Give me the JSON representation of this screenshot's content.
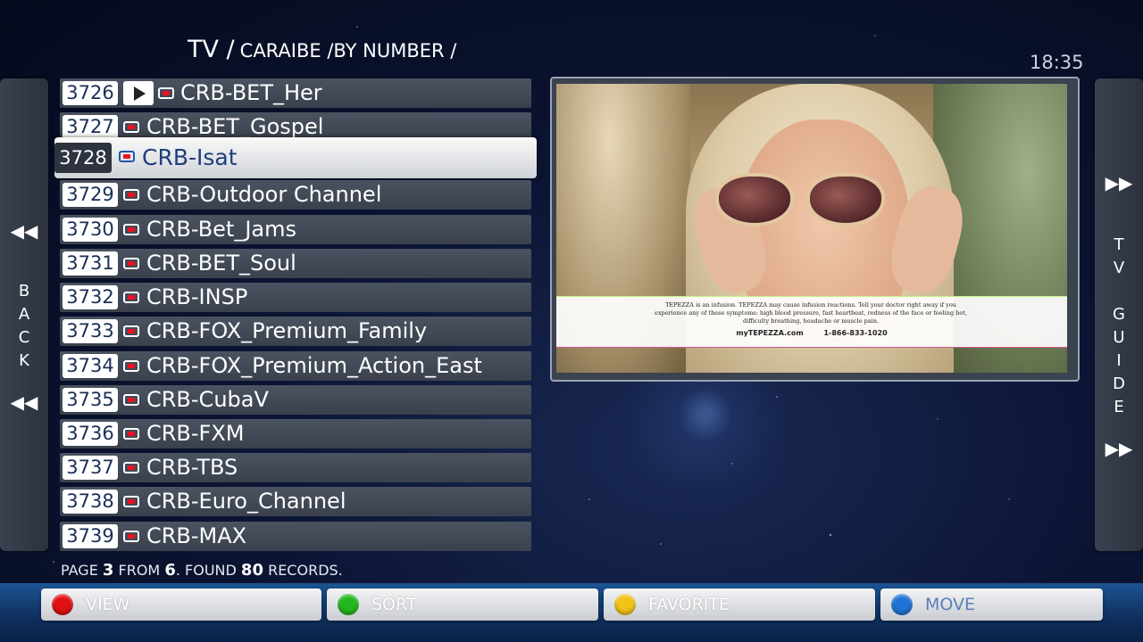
{
  "header": {
    "title_main": "TV /",
    "title_sub": "CARAIBE /BY NUMBER /",
    "clock": "18:35"
  },
  "left_panel": {
    "letters": [
      "B",
      "A",
      "C",
      "K"
    ],
    "arrow_top": "◀◀",
    "arrow_bottom": "◀◀"
  },
  "right_panel": {
    "tv_letters": [
      "T",
      "V"
    ],
    "guide_letters": [
      "G",
      "U",
      "I",
      "D",
      "E"
    ],
    "arrow_top": "▶▶",
    "arrow_bottom": "▶▶"
  },
  "channels": [
    {
      "num": "3726",
      "name": "CRB-BET_Her"
    },
    {
      "num": "3727",
      "name": "CRB-BET_Gospel"
    },
    {
      "num": "3728",
      "name": "CRB-Isat"
    },
    {
      "num": "3729",
      "name": "CRB-Outdoor Channel"
    },
    {
      "num": "3730",
      "name": "CRB-Bet_Jams"
    },
    {
      "num": "3731",
      "name": "CRB-BET_Soul"
    },
    {
      "num": "3732",
      "name": "CRB-INSP"
    },
    {
      "num": "3733",
      "name": "CRB-FOX_Premium_Family"
    },
    {
      "num": "3734",
      "name": "CRB-FOX_Premium_Action_East"
    },
    {
      "num": "3735",
      "name": "CRB-CubaV"
    },
    {
      "num": "3736",
      "name": "CRB-FXM"
    },
    {
      "num": "3737",
      "name": "CRB-TBS"
    },
    {
      "num": "3738",
      "name": "CRB-Euro_Channel"
    },
    {
      "num": "3739",
      "name": "CRB-MAX"
    }
  ],
  "preview": {
    "caption_text": "TEPEZZA is an infusion. TEPEZZA may cause infusion reactions. Tell your doctor right away if you experience any of these symptoms: high blood pressure, fast heartbeat, redness of the face or feeling hot, difficulty breathing, headache or muscle pain.",
    "caption_site": "myTEPEZZA.com",
    "caption_phone": "1-866-833-1020"
  },
  "status": {
    "page_word": "PAGE",
    "page": "3",
    "from_word": "FROM",
    "pages": "6",
    "found_word": ". FOUND",
    "count": "80",
    "records_word": "RECORDS."
  },
  "function_buttons": [
    {
      "label": "VIEW",
      "color": "#e01010"
    },
    {
      "label": "SORT",
      "color": "#22b81e"
    },
    {
      "label": "FAVORITE",
      "color": "#f2c418"
    },
    {
      "label": "MOVE",
      "color": "#1f74d6"
    }
  ]
}
